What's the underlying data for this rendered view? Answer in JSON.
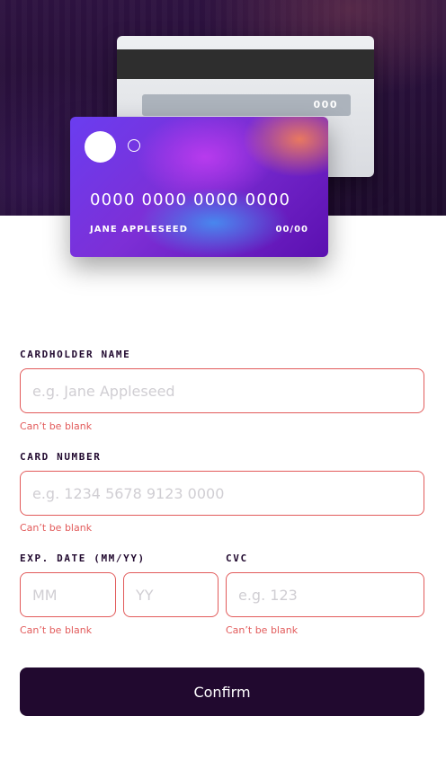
{
  "card_preview": {
    "back": {
      "cvc": "000"
    },
    "front": {
      "number": "0000 0000 0000 0000",
      "name": "JANE APPLESEED",
      "expiry": "00/00"
    }
  },
  "form": {
    "cardholder": {
      "label": "CARDHOLDER NAME",
      "placeholder": "e.g. Jane Appleseed",
      "error": "Can’t be blank"
    },
    "number": {
      "label": "CARD NUMBER",
      "placeholder": "e.g. 1234 5678 9123 0000",
      "error": "Can’t be blank"
    },
    "expiry": {
      "label": "EXP. DATE (MM/YY)",
      "month_placeholder": "MM",
      "year_placeholder": "YY",
      "error": "Can’t be blank"
    },
    "cvc": {
      "label": "CVC",
      "placeholder": "e.g. 123",
      "error": "Can’t be blank"
    },
    "submit_label": "Confirm"
  },
  "colors": {
    "error": "#e25b5b",
    "dark": "#21092f",
    "placeholder": "#d0ced3"
  }
}
